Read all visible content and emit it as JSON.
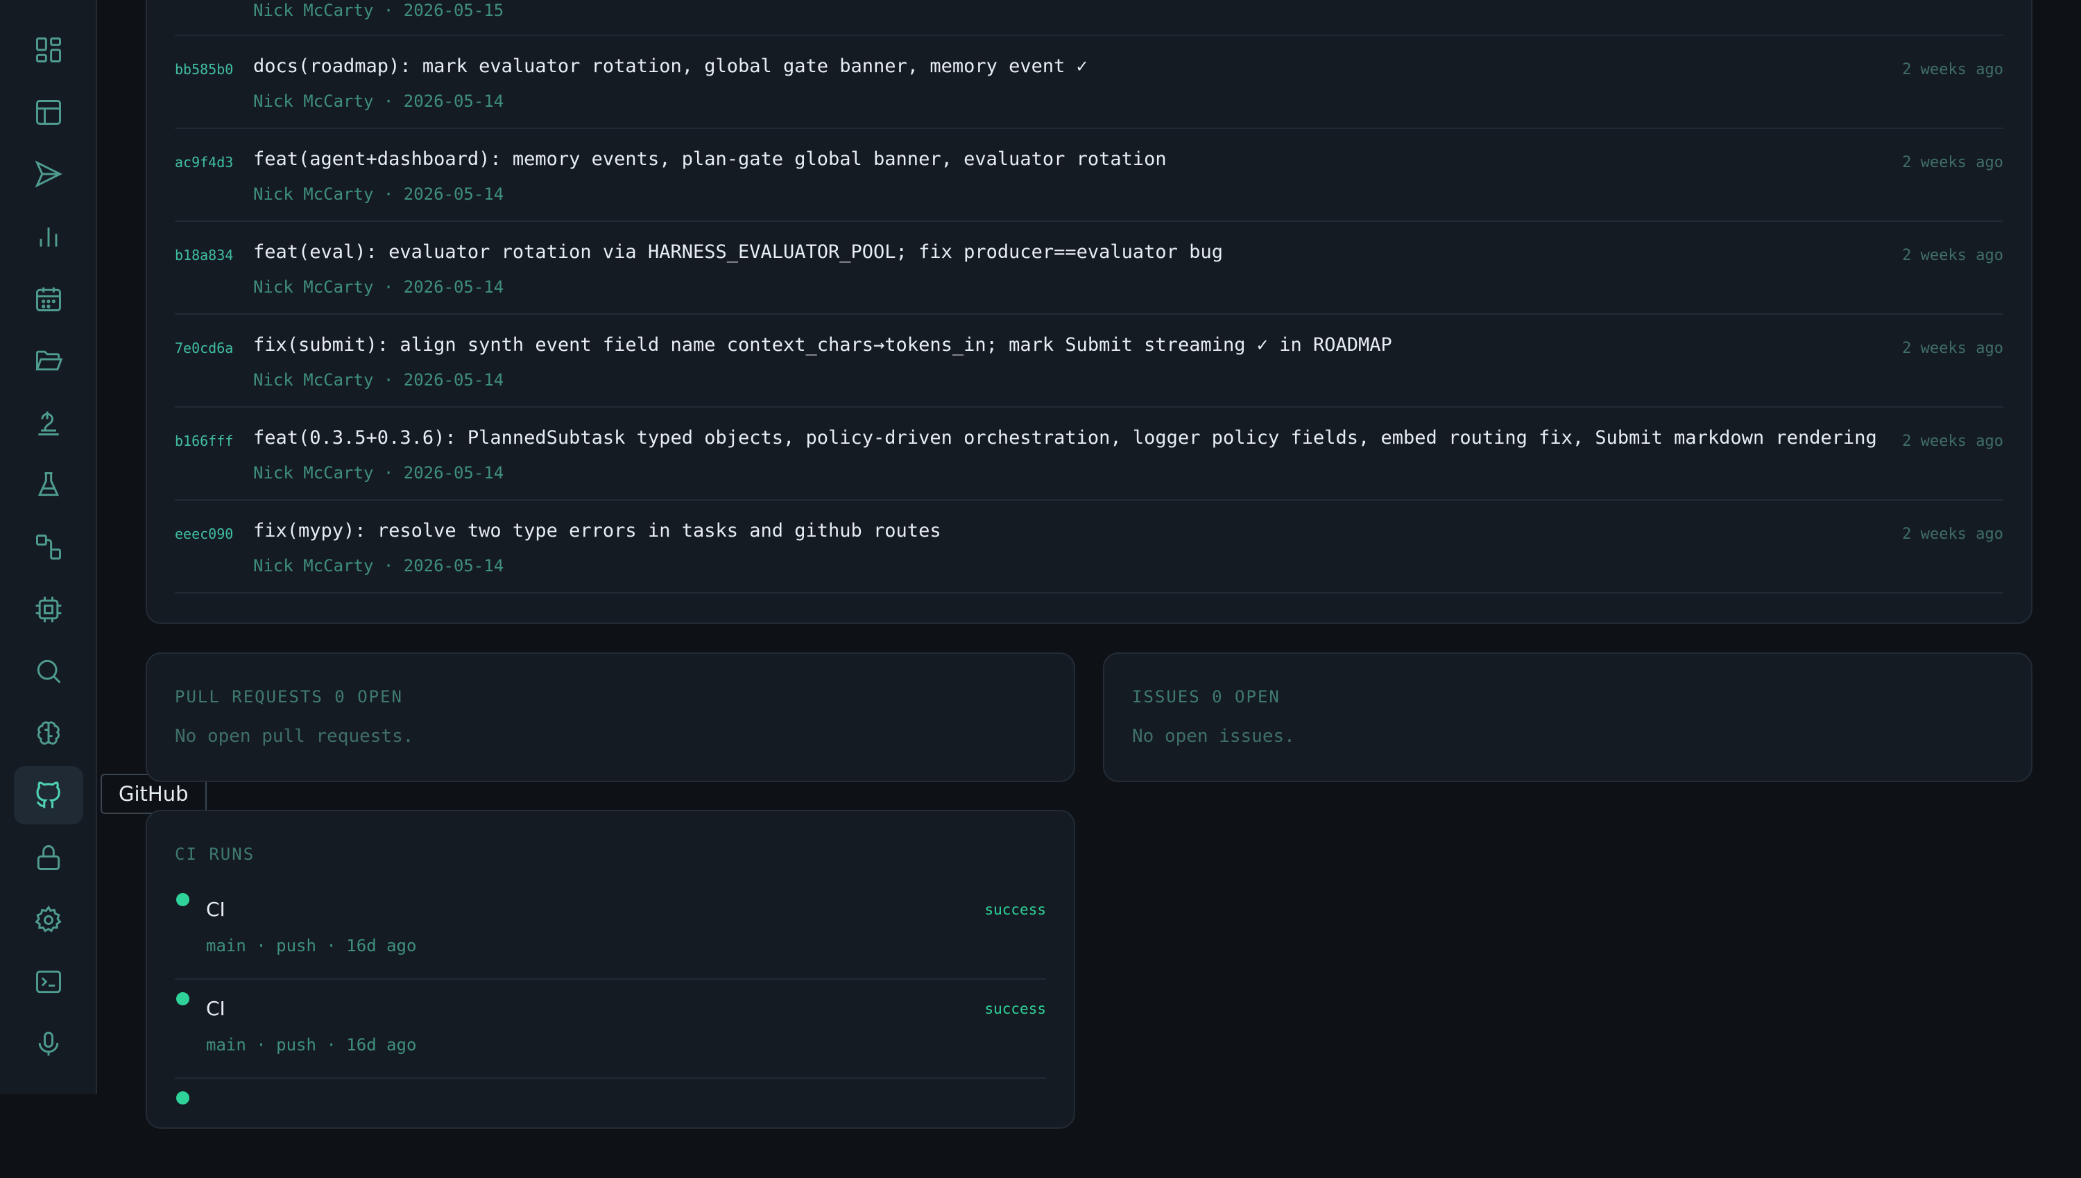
{
  "tooltip": "GitHub",
  "sidebar": {
    "items": [
      {
        "icon": "grid-icon"
      },
      {
        "icon": "table-icon"
      },
      {
        "icon": "send-icon"
      },
      {
        "icon": "bar-chart-icon"
      },
      {
        "icon": "calendar-icon"
      },
      {
        "icon": "folder-open-icon"
      },
      {
        "icon": "lamp-icon"
      },
      {
        "icon": "flask-icon"
      },
      {
        "icon": "workflow-icon"
      },
      {
        "icon": "cpu-icon"
      },
      {
        "icon": "search-icon"
      },
      {
        "icon": "brain-icon"
      },
      {
        "icon": "github-icon",
        "active": true
      },
      {
        "icon": "lock-icon"
      },
      {
        "icon": "gear-icon"
      },
      {
        "icon": "terminal-icon"
      },
      {
        "icon": "microphone-icon"
      }
    ]
  },
  "commits": {
    "partial_meta": "Nick McCarty · 2026-05-15",
    "items": [
      {
        "sha": "bb585b0",
        "message": "docs(roadmap): mark evaluator rotation, global gate banner, memory event ✓",
        "meta": "Nick McCarty · 2026-05-14",
        "when": "2 weeks ago"
      },
      {
        "sha": "ac9f4d3",
        "message": "feat(agent+dashboard): memory events, plan-gate global banner, evaluator rotation",
        "meta": "Nick McCarty · 2026-05-14",
        "when": "2 weeks ago"
      },
      {
        "sha": "b18a834",
        "message": "feat(eval): evaluator rotation via HARNESS_EVALUATOR_POOL; fix producer==evaluator bug",
        "meta": "Nick McCarty · 2026-05-14",
        "when": "2 weeks ago"
      },
      {
        "sha": "7e0cd6a",
        "message": "fix(submit): align synth event field name context_chars→tokens_in; mark Submit streaming ✓ in ROADMAP",
        "meta": "Nick McCarty · 2026-05-14",
        "when": "2 weeks ago"
      },
      {
        "sha": "b166fff",
        "message": "feat(0.3.5+0.3.6): PlannedSubtask typed objects, policy-driven orchestration, logger policy fields, embed routing fix, Submit markdown rendering",
        "meta": "Nick McCarty · 2026-05-14",
        "when": "2 weeks ago"
      },
      {
        "sha": "eeec090",
        "message": "fix(mypy): resolve two type errors in tasks and github routes",
        "meta": "Nick McCarty · 2026-05-14",
        "when": "2 weeks ago"
      }
    ]
  },
  "pull_requests": {
    "title": "PULL REQUESTS 0 OPEN",
    "empty": "No open pull requests."
  },
  "issues": {
    "title": "ISSUES 0 OPEN",
    "empty": "No open issues."
  },
  "ci_runs": {
    "title": "CI RUNS",
    "items": [
      {
        "name": "CI",
        "meta": "main · push · 16d ago",
        "status": "success"
      },
      {
        "name": "CI",
        "meta": "main · push · 16d ago",
        "status": "success"
      }
    ]
  },
  "colors": {
    "accent": "#3fbfa0",
    "success": "#2fd39a",
    "background": "#0e1217",
    "panel": "#151b22"
  }
}
